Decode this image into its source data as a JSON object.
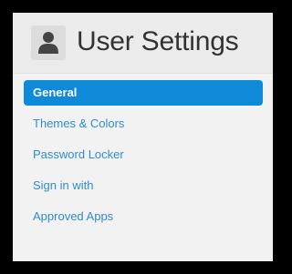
{
  "header": {
    "title": "User Settings",
    "icon": "user-icon"
  },
  "sidebar": {
    "items": [
      {
        "label": "General",
        "active": true
      },
      {
        "label": "Themes & Colors",
        "active": false
      },
      {
        "label": "Password Locker",
        "active": false
      },
      {
        "label": "Sign in with",
        "active": false
      },
      {
        "label": "Approved Apps",
        "active": false
      }
    ]
  },
  "colors": {
    "accent": "#0e8ad8",
    "link": "#2f8ccf",
    "title_text": "#333333",
    "panel_bg": "#f2f2f2",
    "frame": "#000000"
  }
}
